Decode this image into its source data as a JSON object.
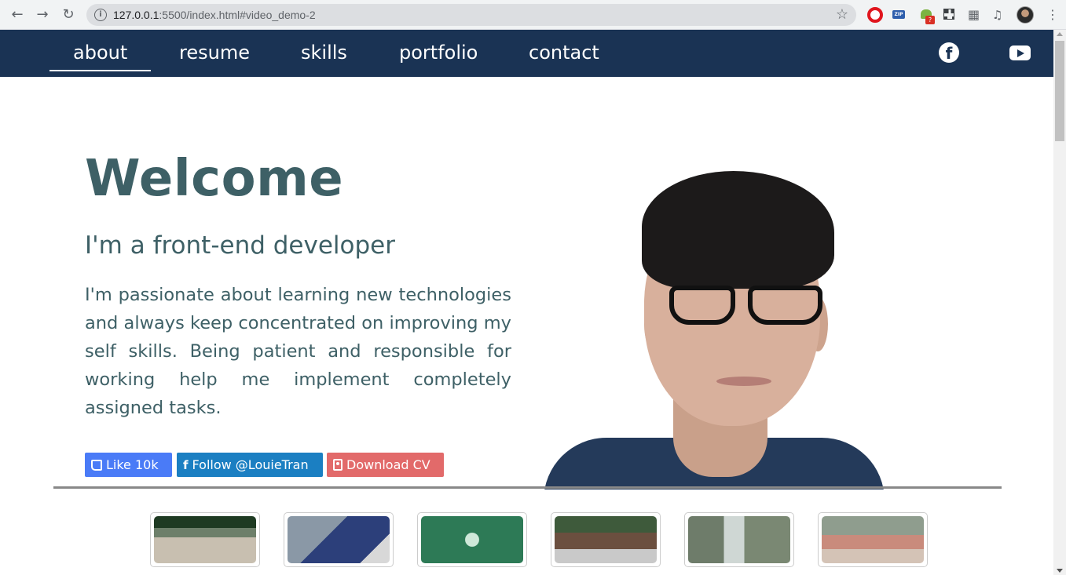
{
  "browser": {
    "url_host": "127.0.0.1",
    "url_rest": ":5500/index.html#video_demo-2",
    "profile_icon": "avatar",
    "extensions": [
      "opera-adblock-icon",
      "zip-icon",
      "android-icon",
      "qr-icon",
      "puzzle-icon",
      "media-queue-icon"
    ],
    "android_badge": "?",
    "zip_label": "ZIP"
  },
  "nav": {
    "links": [
      "about",
      "resume",
      "skills",
      "portfolio",
      "contact"
    ],
    "active": "about",
    "social": [
      "facebook-icon",
      "youtube-icon"
    ],
    "fb_glyph": "f"
  },
  "hero": {
    "title": "Welcome",
    "subtitle": "I'm a front-end developer",
    "bio": "I'm passionate about learning new technologies and always keep concentrated on improving my self skills. Being patient and responsible for working help me implement completely assigned tasks."
  },
  "buttons": {
    "like": "Like 10k",
    "follow": "Follow @LouieTran",
    "follow_glyph": "f",
    "download": "Download CV"
  },
  "colors": {
    "nav_bg": "#1a3354",
    "text": "#3e6066",
    "like": "#4a7bf7",
    "follow": "#1b7fc2",
    "download": "#e26a6a"
  },
  "thumbnails": [
    "video-thumbnail-1",
    "video-thumbnail-2",
    "video-thumbnail-3",
    "video-thumbnail-4",
    "video-thumbnail-5",
    "video-thumbnail-6"
  ]
}
